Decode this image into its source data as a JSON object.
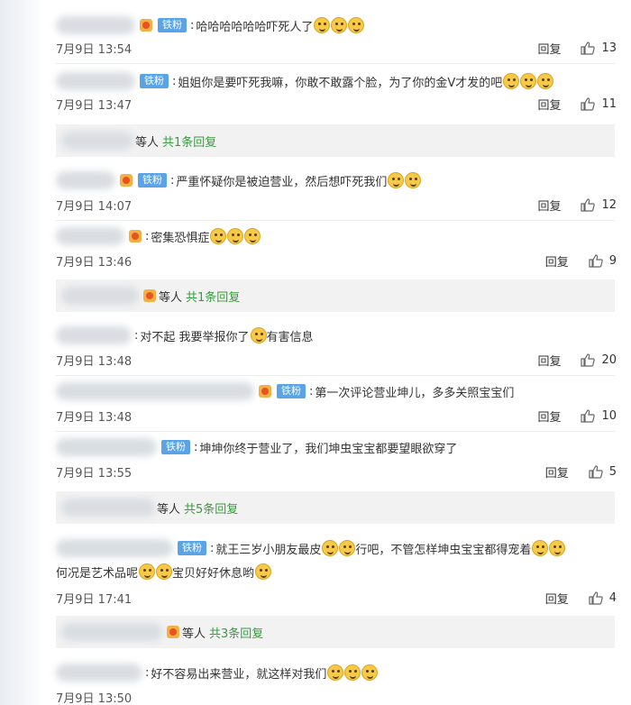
{
  "comments": [
    {
      "name_blur": true,
      "badge": "铁粉",
      "text": "哈哈哈哈哈哈吓死人了",
      "emoji_count": 3,
      "time": "7月9日 13:54",
      "reply": "回复",
      "likes": "13"
    },
    {
      "name_blur": true,
      "badge": "铁粉",
      "text": "姐姐你是要吓死我嘛，你敢不敢露个脸，为了你的金V才发的吧",
      "emoji_count": 3,
      "time": "7月9日 13:47",
      "reply": "回复",
      "likes": "11"
    },
    {
      "name_blur": true,
      "badge": "铁粉",
      "text": "严重怀疑你是被迫营业，然后想吓死我们",
      "emoji_count": 2,
      "time": "7月9日 14:07",
      "reply": "回复",
      "likes": "12"
    },
    {
      "name_blur": true,
      "badge": "",
      "text": "密集恐惧症",
      "emoji_count": 3,
      "time": "7月9日 13:46",
      "reply": "回复",
      "likes": "9"
    },
    {
      "name_blur": true,
      "badge": "",
      "text": "对不起 我要举报你了",
      "text2": "有害信息",
      "emoji_count": 1,
      "time": "7月9日 13:48",
      "reply": "回复",
      "likes": "20"
    },
    {
      "name_blur": true,
      "badge": "铁粉",
      "text": "第一次评论营业坤儿，多多关照宝宝们",
      "emoji_count": 0,
      "time": "7月9日 13:48",
      "reply": "回复",
      "likes": "10"
    },
    {
      "name_blur": true,
      "badge": "铁粉",
      "text": "坤坤你终于营业了，我们坤虫宝宝都要望眼欲穿了",
      "emoji_count": 0,
      "time": "7月9日 13:55",
      "reply": "回复",
      "likes": "5"
    },
    {
      "name_blur": true,
      "badge": "铁粉",
      "text": "就王三岁小朋友最皮",
      "text2": "行吧，不管怎样坤虫宝宝都得宠着",
      "line2a": "何况是艺术品呢",
      "line2b": "宝贝好好休息哟",
      "emoji_count": 2,
      "time": "7月9日 17:41",
      "reply": "回复",
      "likes": "4"
    },
    {
      "name_blur": true,
      "badge": "",
      "text": "好不容易出来营业，就这样对我们",
      "emoji_count": 3,
      "time": "7月9日 13:50",
      "reply": "",
      "likes": ""
    }
  ],
  "subreplies": [
    {
      "teng": "等人",
      "count": "共1条回复"
    },
    {
      "teng": "等人",
      "count": "共1条回复"
    },
    {
      "teng": "等人",
      "count": "共5条回复"
    },
    {
      "teng": "等人",
      "count": "共3条回复"
    }
  ],
  "colors": {
    "badge": "#5aa3e6",
    "reply_count": "#3a9a3f",
    "subreply_bg": "#f2f2f2"
  },
  "icons": {
    "like": "thumbs-up-icon",
    "vip": "vip-badge-icon",
    "emoji": "emoji-icon"
  }
}
